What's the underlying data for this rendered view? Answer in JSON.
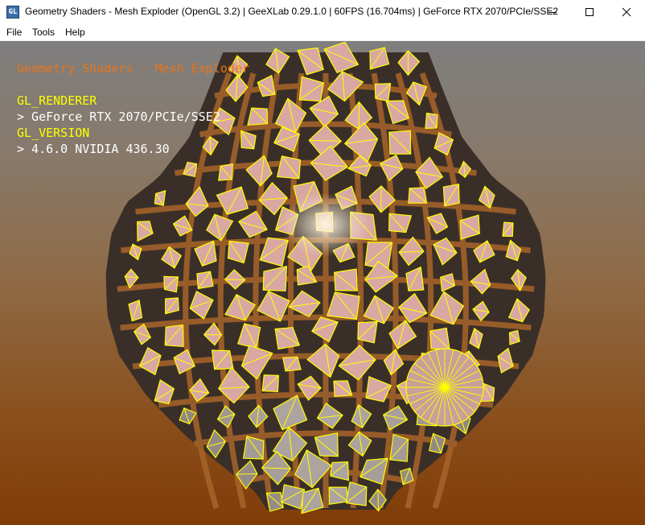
{
  "window": {
    "title": "Geometry Shaders - Mesh Exploder (OpenGL 3.2) | GeeXLab 0.29.1.0 | 60FPS (16.704ms) | GeForce RTX 2070/PCIe/SSE2",
    "app_icon_text": "GL",
    "controls": {
      "minimize": "minimize-icon",
      "maximize": "maximize-icon",
      "close": "close-icon"
    }
  },
  "menu": {
    "items": [
      "File",
      "Tools",
      "Help"
    ]
  },
  "overlay": {
    "demo_title": "Geometry Shaders - Mesh Exploder",
    "renderer_label": "GL_RENDERER",
    "renderer_value": "> GeForce RTX 2070/PCIe/SSE2",
    "version_label": "GL_VERSION",
    "version_value": "> 4.6.0 NVIDIA 436.30"
  },
  "colors": {
    "overlay_title": "#e8741a",
    "overlay_key": "#ffff00",
    "overlay_value": "#ffffff",
    "wireframe": "#ffff00",
    "shard_fill": "#d9a8a3",
    "background_top": "#7f7f7f",
    "background_bottom": "#803c07"
  }
}
